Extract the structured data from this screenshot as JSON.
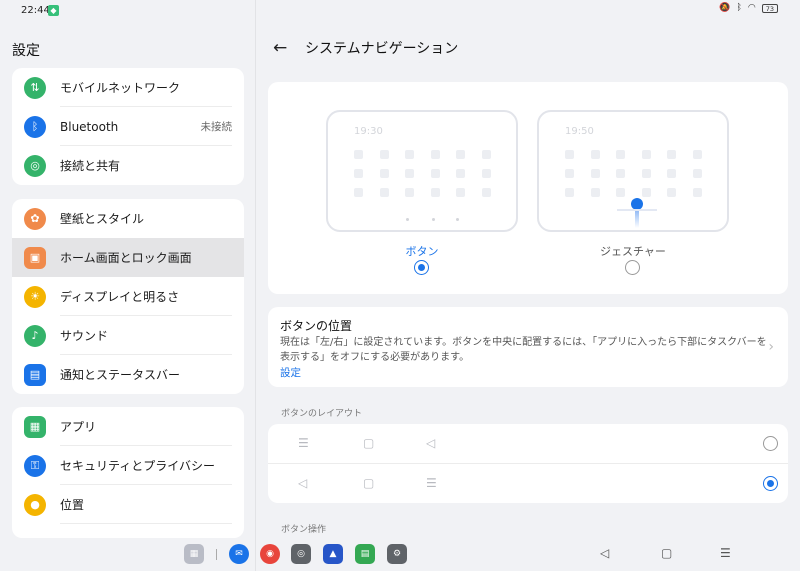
{
  "status": {
    "time": "22:44",
    "battery": "73"
  },
  "sidebar": {
    "title": "設定",
    "groups": [
      {
        "items": [
          {
            "label": "モバイルネットワーク",
            "icon": "mobile-network-icon",
            "color": "#34b36a",
            "glyph": "⇅"
          },
          {
            "label": "Bluetooth",
            "value": "未接続",
            "icon": "bluetooth-icon",
            "color": "#1a73e8",
            "glyph": "ᛒ"
          },
          {
            "label": "接続と共有",
            "icon": "connection-share-icon",
            "color": "#34b36a",
            "glyph": "◎"
          }
        ]
      },
      {
        "items": [
          {
            "label": "壁紙とスタイル",
            "icon": "wallpaper-icon",
            "color": "#f08a4b",
            "glyph": "✿"
          },
          {
            "label": "ホーム画面とロック画面",
            "icon": "home-lock-icon",
            "color": "#f08a4b",
            "glyph": "▣",
            "active": true
          },
          {
            "label": "ディスプレイと明るさ",
            "icon": "display-brightness-icon",
            "color": "#f4b400",
            "glyph": "☀"
          },
          {
            "label": "サウンド",
            "icon": "sound-icon",
            "color": "#34b36a",
            "glyph": "♪"
          },
          {
            "label": "通知とステータスバー",
            "icon": "notification-icon",
            "color": "#1a73e8",
            "glyph": "▤"
          }
        ]
      },
      {
        "items": [
          {
            "label": "アプリ",
            "icon": "apps-icon",
            "color": "#34b36a",
            "glyph": "▦"
          },
          {
            "label": "セキュリティとプライバシー",
            "icon": "security-icon",
            "color": "#1a73e8",
            "glyph": "🔒"
          },
          {
            "label": "位置",
            "icon": "location-icon",
            "color": "#f4b400",
            "glyph": "●"
          }
        ]
      }
    ]
  },
  "page": {
    "title": "システムナビゲーション",
    "options": [
      {
        "label": "ボタン",
        "time": "19:30",
        "selected": true
      },
      {
        "label": "ジェスチャー",
        "time": "19:50",
        "selected": false
      }
    ],
    "button_position": {
      "title": "ボタンの位置",
      "description": "現在は「左/右」に設定されています。ボタンを中央に配置するには、「アプリに入ったら下部にタスクバーを表示する」をオフにする必要があります。",
      "link": "設定"
    },
    "layout_caption": "ボタンのレイアウト",
    "layouts": [
      {
        "glyphs": [
          "☰",
          "▢",
          "◁"
        ],
        "selected": false
      },
      {
        "glyphs": [
          "◁",
          "▢",
          "☰"
        ],
        "selected": true
      }
    ],
    "operation_caption": "ボタン操作"
  },
  "dock": {
    "accent": "#1a73e8",
    "sysnav": {
      "back": "◁",
      "home": "▢",
      "recents": "☰"
    }
  }
}
